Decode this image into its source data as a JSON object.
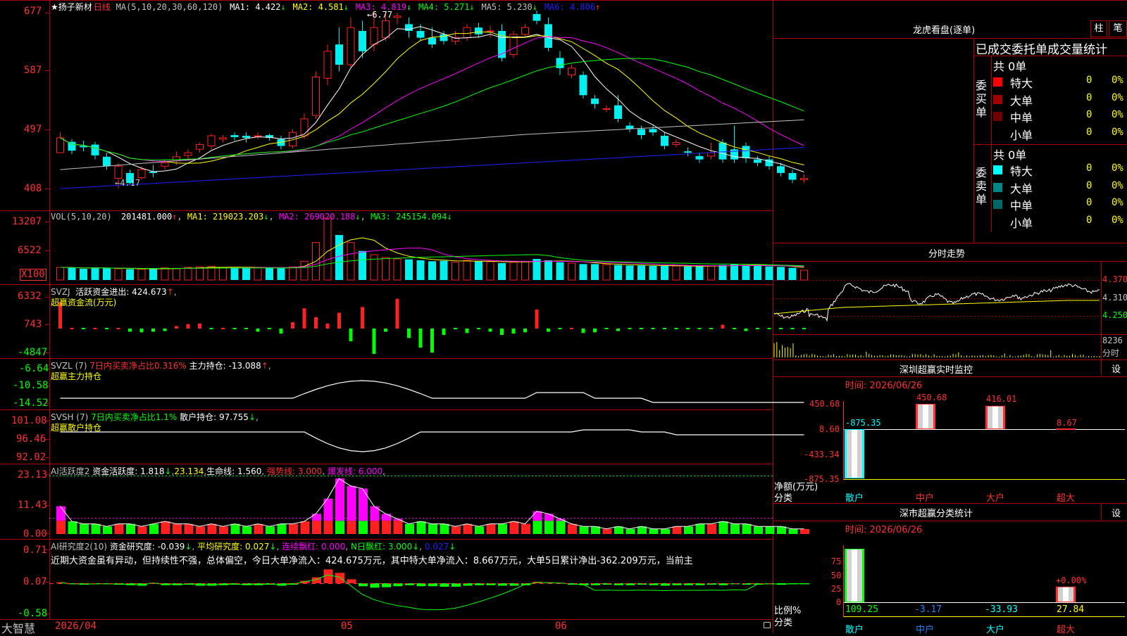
{
  "colors": {
    "grid": "#b00000",
    "up": "#ff2020",
    "down": "#00f0f0",
    "ma1": "#ffffff",
    "ma2": "#ffff00",
    "ma3": "#ff00ff",
    "ma4": "#00ff00",
    "ma5": "#c0c0c0",
    "ma6": "#2020ff",
    "green": "#00ff00",
    "magenta": "#ff00ff"
  },
  "kline": {
    "star": "★",
    "stock_name": "扬子新材",
    "period": "日线",
    "ma_params": "MA(5,10,20,30,60,120)",
    "ma_legend": [
      {
        "label": "MA1:",
        "value": "4.422",
        "arrow": "↓"
      },
      {
        "label": "MA2:",
        "value": "4.581",
        "arrow": "↓"
      },
      {
        "label": "MA3:",
        "value": "4.819",
        "arrow": "↓"
      },
      {
        "label": "MA4:",
        "value": "5.271",
        "arrow": "↓"
      },
      {
        "label": "MA5:",
        "value": "5.230",
        "arrow": "↓"
      },
      {
        "label": "MA6:",
        "value": "4.806",
        "arrow": "↑"
      }
    ],
    "y_labels": [
      "677",
      "587",
      "497",
      "408"
    ],
    "high_label": "6.77",
    "low_label": "4.17",
    "candles": [
      [
        4.7,
        4.92,
        4.8,
        5.0
      ],
      [
        4.86,
        4.73,
        4.68,
        4.9
      ],
      [
        4.8,
        4.78,
        4.72,
        4.88
      ],
      [
        4.82,
        4.66,
        4.6,
        4.86
      ],
      [
        4.64,
        4.5,
        4.45,
        4.7
      ],
      [
        4.32,
        4.5,
        4.17,
        4.55
      ],
      [
        4.4,
        4.25,
        4.22,
        4.45
      ],
      [
        4.33,
        4.45,
        4.3,
        4.5
      ],
      [
        4.42,
        4.4,
        4.34,
        4.52
      ],
      [
        4.5,
        4.55,
        4.45,
        4.6
      ],
      [
        4.58,
        4.64,
        4.52,
        4.72
      ],
      [
        4.66,
        4.7,
        4.6,
        4.75
      ],
      [
        4.75,
        4.82,
        4.7,
        4.85
      ],
      [
        4.8,
        4.95,
        4.75,
        4.98
      ],
      [
        4.9,
        4.92,
        4.85,
        4.96
      ],
      [
        4.96,
        4.93,
        4.88,
        5.0
      ],
      [
        4.95,
        4.92,
        4.85,
        5.0
      ],
      [
        4.95,
        4.95,
        4.9,
        5.0
      ],
      [
        4.96,
        4.92,
        4.88,
        4.98
      ],
      [
        4.9,
        4.8,
        4.75,
        4.95
      ],
      [
        4.8,
        5.0,
        4.76,
        5.05
      ],
      [
        4.95,
        5.2,
        4.9,
        5.28
      ],
      [
        5.25,
        5.82,
        5.2,
        5.9
      ],
      [
        5.8,
        6.2,
        5.7,
        6.3
      ],
      [
        6.3,
        6.0,
        5.9,
        6.55
      ],
      [
        6.0,
        6.55,
        5.95,
        6.7
      ],
      [
        6.5,
        6.2,
        6.1,
        6.65
      ],
      [
        6.3,
        6.55,
        6.2,
        6.8
      ],
      [
        6.4,
        6.65,
        6.35,
        6.77
      ],
      [
        6.7,
        6.72,
        6.6,
        6.77
      ],
      [
        6.6,
        6.5,
        6.4,
        6.7
      ],
      [
        6.5,
        6.4,
        6.35,
        6.6
      ],
      [
        6.4,
        6.3,
        6.25,
        6.55
      ],
      [
        6.45,
        6.35,
        6.3,
        6.5
      ],
      [
        6.35,
        6.4,
        6.3,
        6.5
      ],
      [
        6.4,
        6.55,
        6.35,
        6.6
      ],
      [
        6.55,
        6.45,
        6.4,
        6.62
      ],
      [
        6.5,
        6.5,
        6.4,
        6.58
      ],
      [
        6.5,
        6.1,
        6.05,
        6.6
      ],
      [
        6.15,
        6.45,
        6.1,
        6.5
      ],
      [
        6.45,
        6.55,
        6.4,
        6.6
      ],
      [
        6.75,
        6.65,
        6.6,
        6.8
      ],
      [
        6.6,
        6.25,
        6.2,
        6.7
      ],
      [
        6.1,
        5.95,
        5.85,
        6.2
      ],
      [
        5.85,
        5.95,
        5.8,
        6.0
      ],
      [
        5.85,
        5.55,
        5.5,
        5.9
      ],
      [
        5.5,
        5.42,
        5.35,
        5.55
      ],
      [
        5.35,
        5.35,
        5.3,
        5.4
      ],
      [
        5.4,
        5.2,
        5.15,
        5.55
      ],
      [
        5.1,
        5.05,
        5.0,
        5.15
      ],
      [
        5.05,
        4.96,
        4.9,
        5.1
      ],
      [
        5.05,
        5.0,
        4.95,
        5.1
      ],
      [
        4.95,
        4.8,
        4.75,
        5.0
      ],
      [
        4.82,
        4.85,
        4.78,
        4.9
      ],
      [
        4.72,
        4.7,
        4.65,
        4.78
      ],
      [
        4.65,
        4.6,
        4.55,
        4.7
      ],
      [
        4.65,
        4.7,
        4.6,
        4.85
      ],
      [
        4.85,
        4.6,
        4.55,
        4.9
      ],
      [
        4.75,
        4.6,
        4.55,
        5.1
      ],
      [
        4.8,
        4.62,
        4.55,
        4.85
      ],
      [
        4.6,
        4.55,
        4.5,
        4.65
      ],
      [
        4.6,
        4.5,
        4.45,
        4.65
      ],
      [
        4.5,
        4.4,
        4.35,
        4.55
      ],
      [
        4.4,
        4.3,
        4.25,
        4.45
      ],
      [
        4.3,
        4.32,
        4.25,
        4.38
      ]
    ]
  },
  "vol": {
    "params": "VOL(5,10,20)",
    "value": "201481.000",
    "arrow": "↑",
    "legend": [
      {
        "label": "MA1:",
        "value": "219023.203",
        "arrow": "↓"
      },
      {
        "label": "MA2:",
        "value": "269020.188",
        "arrow": "↓"
      },
      {
        "label": "MA3:",
        "value": "245154.094",
        "arrow": "↓"
      }
    ],
    "y_labels": [
      "13207",
      "6522"
    ],
    "unit_label": "X100",
    "bars": [
      27,
      26,
      24,
      26,
      25,
      24,
      23,
      23,
      24,
      26,
      25,
      27,
      28,
      29,
      26,
      27,
      26,
      27,
      26,
      25,
      28,
      40,
      80,
      132,
      96,
      80,
      62,
      54,
      48,
      45,
      44,
      42,
      40,
      41,
      38,
      42,
      40,
      39,
      36,
      38,
      40,
      45,
      42,
      38,
      36,
      34,
      34,
      33,
      32,
      31,
      31,
      30,
      30,
      30,
      29,
      29,
      30,
      32,
      34,
      32,
      31,
      29,
      28,
      26,
      21
    ]
  },
  "svzj": {
    "name": "SVZJ",
    "title": "活跃资金进出:",
    "value": "424.673",
    "arrow": "↑",
    "subtitle": "超赢资金流(万元)",
    "y_labels": [
      "6332",
      "743",
      "-4847"
    ],
    "bars": [
      4200,
      300,
      -100,
      200,
      -200,
      150,
      -500,
      -600,
      -500,
      -400,
      400,
      700,
      800,
      -200,
      200,
      -300,
      -250,
      -500,
      -300,
      -800,
      1000,
      3200,
      1800,
      800,
      2500,
      -2000,
      3400,
      -4000,
      -500,
      4700,
      -1500,
      -3000,
      -3800,
      -1000,
      -300,
      -700,
      -200,
      -500,
      -1000,
      -800,
      -600,
      3000,
      -500,
      -300,
      200,
      -700,
      -600,
      -300,
      -400,
      -300,
      -200,
      -300,
      -200,
      -300,
      -200,
      -150,
      -100,
      600,
      -300,
      -400,
      -250,
      -200,
      -150,
      -200,
      -100
    ]
  },
  "svzl": {
    "name": "SVZL",
    "param": "(7)",
    "title": "7日内买卖净占比0.316%",
    "label": "主力持仓:",
    "value": "-13.088",
    "arrow": "↑",
    "subtitle": "超赢主力持仓",
    "y_labels": [
      "-6.64",
      "-10.58",
      "-14.52"
    ]
  },
  "svsh": {
    "name": "SVSH",
    "param": "(7)",
    "title": "7日内买卖净占比1.1%",
    "label": "散户持仓:",
    "value": "97.755",
    "arrow": "↓",
    "subtitle": "超赢散户持仓",
    "y_labels": [
      "101.08",
      "96.46",
      "92.02"
    ]
  },
  "ai_active": {
    "name": "AI活跃度2",
    "label1": "资金活跃度:",
    "value1": "1.818",
    "arrow1": "↓",
    "value2": "23.134",
    "label3": "生命线:",
    "value3": "1.560",
    "strong_line": "强势线: 3.000",
    "burst_line": "爆发线: 6.000",
    "y_labels": [
      "23.13",
      "11.43",
      "0.00"
    ],
    "bars": [
      11,
      5,
      4,
      4,
      3,
      4,
      4,
      3,
      4,
      5,
      4,
      4,
      3,
      4,
      3,
      4,
      3,
      4,
      3,
      4,
      4,
      5,
      8,
      14,
      22,
      19,
      18,
      11,
      8,
      6,
      4,
      5,
      4,
      4,
      3,
      4,
      3,
      4,
      4,
      5,
      4,
      9,
      8,
      6,
      4,
      3,
      3,
      2,
      3,
      2,
      3,
      2,
      2,
      3,
      3,
      4,
      4,
      5,
      4,
      4,
      3,
      3,
      3,
      2,
      2
    ]
  },
  "ai_research": {
    "name": "AI研究度2(10)",
    "label1": "资金研究度:",
    "value1": "-0.039",
    "arrow1": "↓",
    "label2": "平均研究度:",
    "value2": "0.027",
    "arrow2": "↓",
    "label3": "连续飘红:",
    "value3": "0.000",
    "label4": "N日飘红:",
    "value4": "3.000",
    "arrow4": "↓",
    "value5": "0.027",
    "arrow5": "↓",
    "comment": "近期大资金虽有异动，但持续性不强，总体偏空，今日大单净流入：424.675万元，其中特大单净流入：8.667万元，大单5日累计净出-362.209万元，当前主",
    "y_labels": [
      "0.71",
      "0.07",
      "-0.58"
    ],
    "bars": [
      0.02,
      -0.02,
      -0.03,
      -0.02,
      -0.02,
      -0.03,
      -0.04,
      -0.05,
      0.01,
      -0.04,
      -0.04,
      -0.03,
      -0.05,
      -0.05,
      -0.04,
      -0.03,
      -0.04,
      -0.04,
      -0.03,
      -0.05,
      -0.03,
      0.05,
      0.12,
      0.28,
      0.21,
      0.08,
      -0.06,
      -0.09,
      -0.08,
      -0.06,
      -0.04,
      -0.06,
      -0.06,
      -0.07,
      -0.07,
      -0.05,
      -0.04,
      -0.04,
      -0.05,
      -0.05,
      -0.04,
      0.03,
      0.02,
      0.01,
      -0.03,
      -0.04,
      -0.04,
      -0.03,
      -0.04,
      -0.04,
      -0.03,
      -0.04,
      -0.05,
      -0.04,
      -0.04,
      -0.04,
      -0.03,
      -0.04,
      -0.02,
      -0.03,
      -0.03,
      -0.02,
      -0.03,
      -0.02,
      -0.02
    ]
  },
  "x_axis": {
    "labels": [
      "2026/04",
      "05",
      "06"
    ],
    "brand": "大智慧"
  },
  "right_panel": {
    "dragon_title": "龙虎看盘(逐单)",
    "btn_bar": "柱",
    "btn_stroke": "笔",
    "table_title": "已成交委托单成交量统计",
    "buy_side": "委买单",
    "sell_side": "委卖单",
    "buy_total": "共 0单",
    "sell_total": "共 0单",
    "buy_rows": [
      {
        "label": "特大",
        "count": "0",
        "pct": "0%",
        "color": "#ff0000"
      },
      {
        "label": "大单",
        "count": "0",
        "pct": "0%",
        "color": "#a00000"
      },
      {
        "label": "中单",
        "count": "0",
        "pct": "0%",
        "color": "#700000"
      },
      {
        "label": "小单",
        "count": "0",
        "pct": "0%",
        "color": ""
      }
    ],
    "sell_rows": [
      {
        "label": "特大",
        "count": "0",
        "pct": "0%",
        "color": "#00ffff"
      },
      {
        "label": "大单",
        "count": "0",
        "pct": "0%",
        "color": "#008888"
      },
      {
        "label": "中单",
        "count": "0",
        "pct": "0%",
        "color": "#006666"
      },
      {
        "label": "小单",
        "count": "0",
        "pct": "0%",
        "color": ""
      }
    ],
    "intraday_title": "分时走势",
    "intraday_y": [
      "4.370",
      "4.310",
      "4.250"
    ],
    "intraday_vol_y": "8236",
    "intraday_vol_unit": "分时",
    "sz_monitor_title": "深圳超赢实时监控",
    "sz_monitor_btn": "设",
    "sz_monitor_time": "时间: 2026/06/26",
    "sz_monitor_y": [
      "450.68",
      "8.60",
      "-433.34",
      "-875.35"
    ],
    "sz_monitor_axis_label": "净额(万元)",
    "sz_monitor_axis_label2": "分类",
    "sz_monitor_cats": [
      "散户",
      "中户",
      "大户",
      "超大"
    ],
    "sz_monitor_values": [
      -875.35,
      450.68,
      416.01,
      8.67
    ],
    "sz_monitor_value_labels": [
      "-875.35",
      "450.68",
      "416.01",
      "8.67"
    ],
    "sz_class_title": "深市超赢分类统计",
    "sz_class_btn": "设",
    "sz_class_time": "时间: 2026/06/26",
    "sz_class_y": [
      "75",
      "50",
      "25",
      "0"
    ],
    "sz_class_axis_label": "比例%",
    "sz_class_axis_label2": "分类",
    "sz_class_cats": [
      "散户",
      "中户",
      "大户",
      "超大"
    ],
    "sz_class_values": [
      109.25,
      -3.17,
      -33.93,
      27.84
    ],
    "sz_class_value_labels": [
      "109.25",
      "-3.17",
      "-33.93",
      "27.84"
    ],
    "sz_class_top_label": "+0.00%"
  }
}
